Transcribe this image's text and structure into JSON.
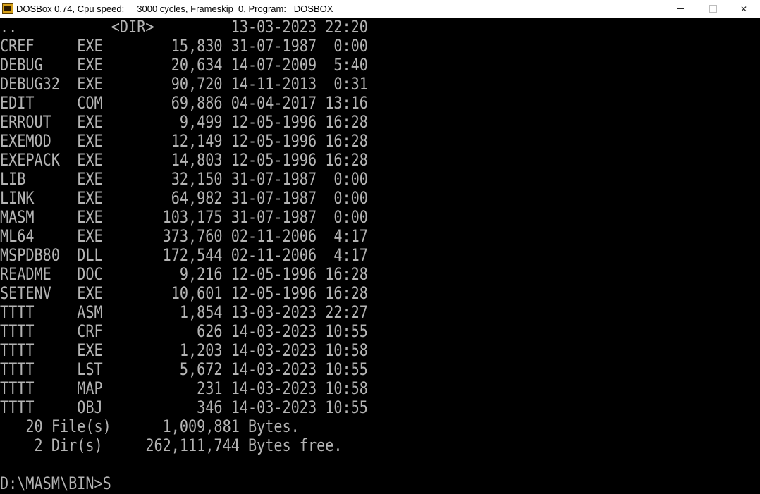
{
  "window": {
    "title": "DOSBox 0.74, Cpu speed:     3000 cycles, Frameskip  0, Program:   DOSBOX",
    "minimize_glyph": "—",
    "maximize_glyph": "□",
    "close_glyph": "✕"
  },
  "console": {
    "lines": [
      "..           <DIR>         13-03-2023 22:20",
      "CREF     EXE        15,830 31-07-1987  0:00",
      "DEBUG    EXE        20,634 14-07-2009  5:40",
      "DEBUG32  EXE        90,720 14-11-2013  0:31",
      "EDIT     COM        69,886 04-04-2017 13:16",
      "ERROUT   EXE         9,499 12-05-1996 16:28",
      "EXEMOD   EXE        12,149 12-05-1996 16:28",
      "EXEPACK  EXE        14,803 12-05-1996 16:28",
      "LIB      EXE        32,150 31-07-1987  0:00",
      "LINK     EXE        64,982 31-07-1987  0:00",
      "MASM     EXE       103,175 31-07-1987  0:00",
      "ML64     EXE       373,760 02-11-2006  4:17",
      "MSPDB80  DLL       172,544 02-11-2006  4:17",
      "README   DOC         9,216 12-05-1996 16:28",
      "SETENV   EXE        10,601 12-05-1996 16:28",
      "TTTT     ASM         1,854 13-03-2023 22:27",
      "TTTT     CRF           626 14-03-2023 10:55",
      "TTTT     EXE         1,203 14-03-2023 10:58",
      "TTTT     LST         5,672 14-03-2023 10:55",
      "TTTT     MAP           231 14-03-2023 10:58",
      "TTTT     OBJ           346 14-03-2023 10:55",
      "   20 File(s)      1,009,881 Bytes.",
      "    2 Dir(s)     262,111,744 Bytes free.",
      "",
      "D:\\MASM\\BIN>S"
    ]
  },
  "colors": {
    "console_background": "#000000",
    "console_text": "#b4b4b4",
    "titlebar_background": "#ffffff"
  }
}
